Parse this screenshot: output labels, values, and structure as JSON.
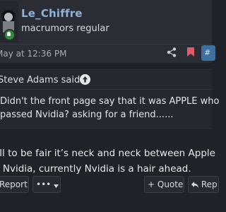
{
  "user": {
    "name": "Le_Chiffre",
    "title": "macrumors regular"
  },
  "post": {
    "timestamp": "May at 12:36 PM",
    "number_fragment": "#",
    "quote": {
      "author_label": "Steve Adams said:",
      "lines": [
        "Didn't the front page say that it was APPLE who",
        "passed Nvidia? asking for a friend......"
      ]
    },
    "body_lines": [
      "ell to be fair it’s neck and neck between Apple",
      "d Nvidia, currently Nvidia is a hair ahead."
    ]
  },
  "actions": {
    "report": "Report",
    "more": "•••",
    "quote": "+ Quote",
    "reply_fragment": "Rep"
  },
  "icons": {
    "share": "share-icon",
    "bookmark": "bookmark-icon",
    "quote_arrow": "arrow-up-circle-icon",
    "status": "status-icon"
  },
  "colors": {
    "username": "#8fb4d9",
    "background": "#1f2227",
    "header": "#2a2d33",
    "bookmark": "#e05a67",
    "status": "#2f8e3b",
    "post_number": "#3d6f9f"
  }
}
